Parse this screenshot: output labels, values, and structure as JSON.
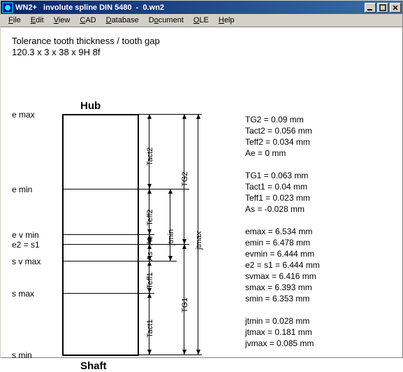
{
  "title": "WN2+   involute spline DIN 5480  -  0.wn2",
  "menu": [
    "File",
    "Edit",
    "View",
    "CAD",
    "Database",
    "Document",
    "OLE",
    "Help"
  ],
  "menu_ul": [
    "F",
    "E",
    "V",
    "C",
    "D",
    "D",
    "O",
    "H"
  ],
  "heading1": "Tolerance tooth thickness / tooth gap",
  "heading2": "120.3 x 3 x 38 x 9H 8f",
  "hub_label": "Hub",
  "shaft_label": "Shaft",
  "row_labels": {
    "emax": "e max",
    "emin": "e min",
    "evmin": "e v min",
    "e2s1": "e2 = s1",
    "svmax": "s v max",
    "smax": "s max",
    "smin": "s min"
  },
  "dim_labels": {
    "tact2": "Tact2",
    "teff2": "Teff2",
    "ae": "Ae",
    "as": "As",
    "teff1": "Teff1",
    "tact1": "Tact1",
    "tg2": "TG2",
    "jtmin": "jtmin",
    "tg1": "TG1",
    "jtmax": "jtmax"
  },
  "values": {
    "g1": [
      "TG2 = 0.09 mm",
      "Tact2 = 0.056 mm",
      "Teff2 = 0.034 mm",
      "Ae = 0 mm"
    ],
    "g2": [
      "TG1 = 0.063 mm",
      "Tact1 = 0.04 mm",
      "Teff1 = 0.023 mm",
      "As = -0.028 mm"
    ],
    "g3": [
      "emax = 6.534 mm",
      "emin = 6.478 mm",
      "evmin = 6.444 mm",
      "e2 = s1 = 6.444 mm",
      "svmax = 6.416 mm",
      "smax = 6.393 mm",
      "smin = 6.353 mm"
    ],
    "g4": [
      "jtmin = 0.028 mm",
      "jtmax = 0.181 mm",
      "jvmax = 0.085 mm"
    ]
  },
  "chart_data": {
    "type": "table",
    "title": "Tolerance tooth thickness / tooth gap",
    "designation": "120.3 x 3 x 38 x 9H 8f",
    "tolerances_mm": {
      "TG2": 0.09,
      "Tact2": 0.056,
      "Teff2": 0.034,
      "Ae": 0,
      "TG1": 0.063,
      "Tact1": 0.04,
      "Teff1": 0.023,
      "As": -0.028
    },
    "limits_mm": {
      "emax": 6.534,
      "emin": 6.478,
      "evmin": 6.444,
      "e2_s1": 6.444,
      "svmax": 6.416,
      "smax": 6.393,
      "smin": 6.353
    },
    "clearance_mm": {
      "jtmin": 0.028,
      "jtmax": 0.181,
      "jvmax": 0.085
    },
    "stack_order": [
      "e max",
      "e min",
      "e v min",
      "e2 = s1",
      "s v max",
      "s max",
      "s min"
    ]
  }
}
